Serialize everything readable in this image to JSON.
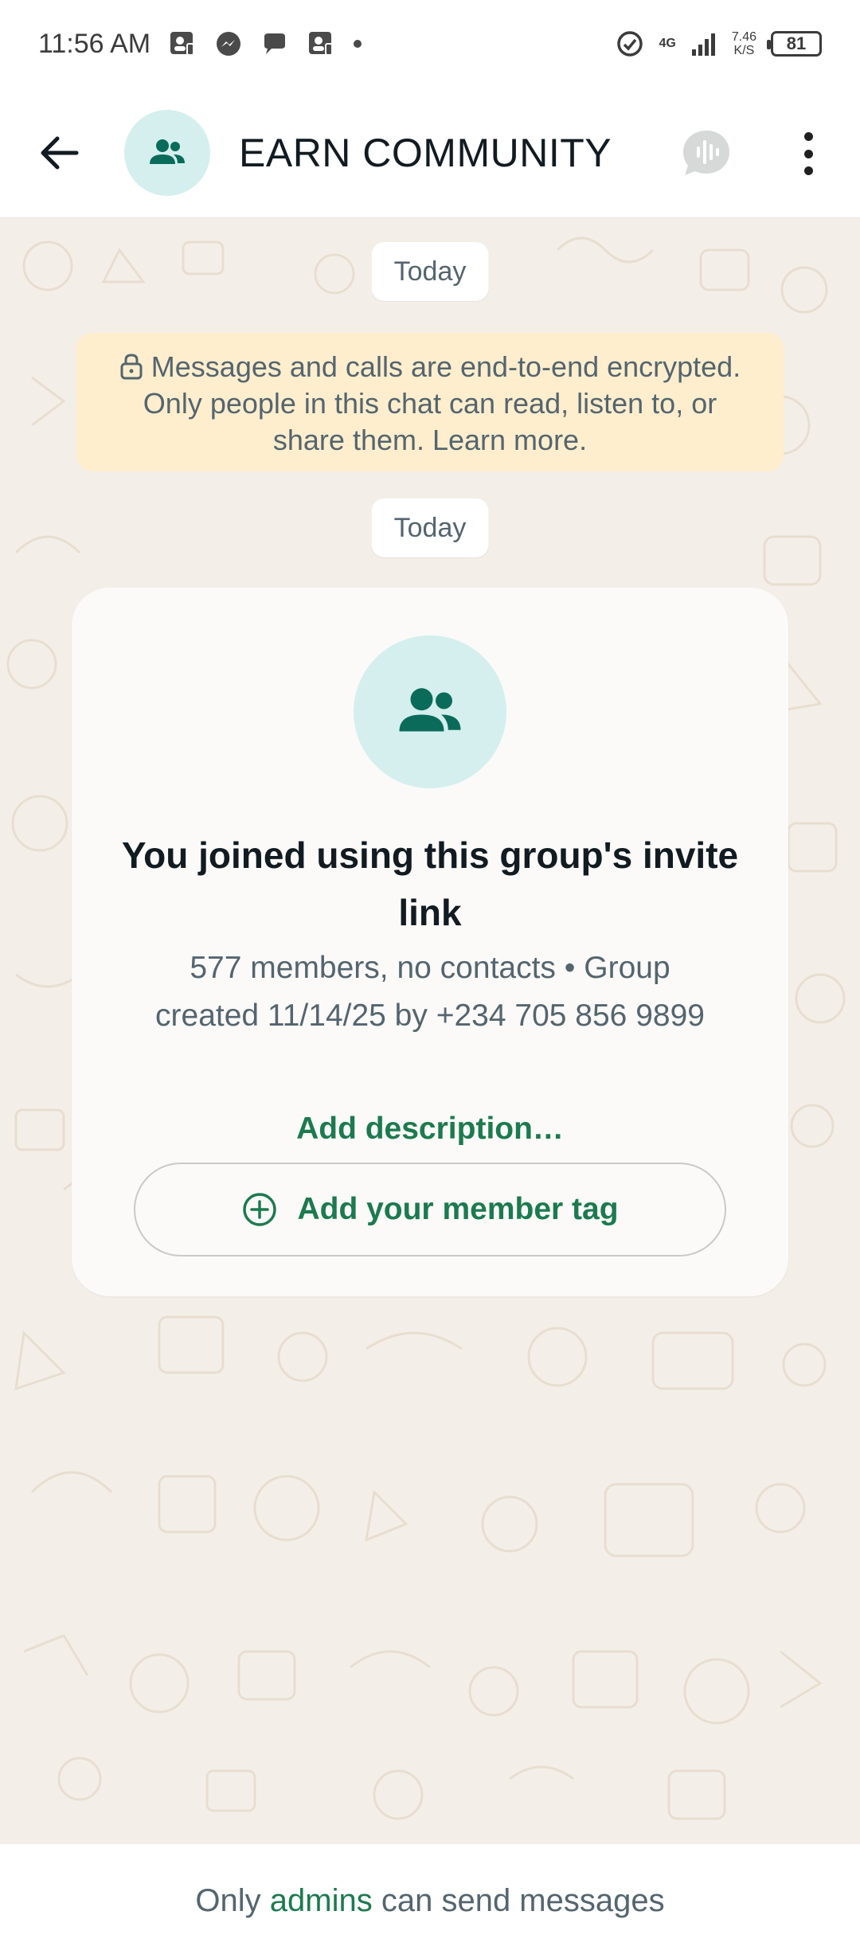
{
  "status_bar": {
    "time": "11:56 AM",
    "network_type": "4G",
    "net_speed_value": "7.46",
    "net_speed_unit": "K/S",
    "battery": "81"
  },
  "header": {
    "title": "EARN COMMUNITY"
  },
  "chat": {
    "date_label_1": "Today",
    "encryption_text": "Messages and calls are end-to-end encrypted. Only people in this chat can read, listen to, or share them. Learn more.",
    "date_label_2": "Today",
    "system_card": {
      "title": "You joined using this group's invite link",
      "meta": "577 members, no contacts • Group created 11/14/25 by +234 705 856 9899",
      "add_description": "Add description…",
      "member_tag_button": "Add your member tag"
    }
  },
  "footer": {
    "prefix": "Only",
    "link": "admins",
    "suffix": "can send messages"
  },
  "colors": {
    "accent_green": "#1c7a4f",
    "avatar_bg": "#d4efee",
    "avatar_icon": "#0b6b5a",
    "chat_bg": "#f3efe8",
    "notice_bg": "#ffeecd"
  }
}
